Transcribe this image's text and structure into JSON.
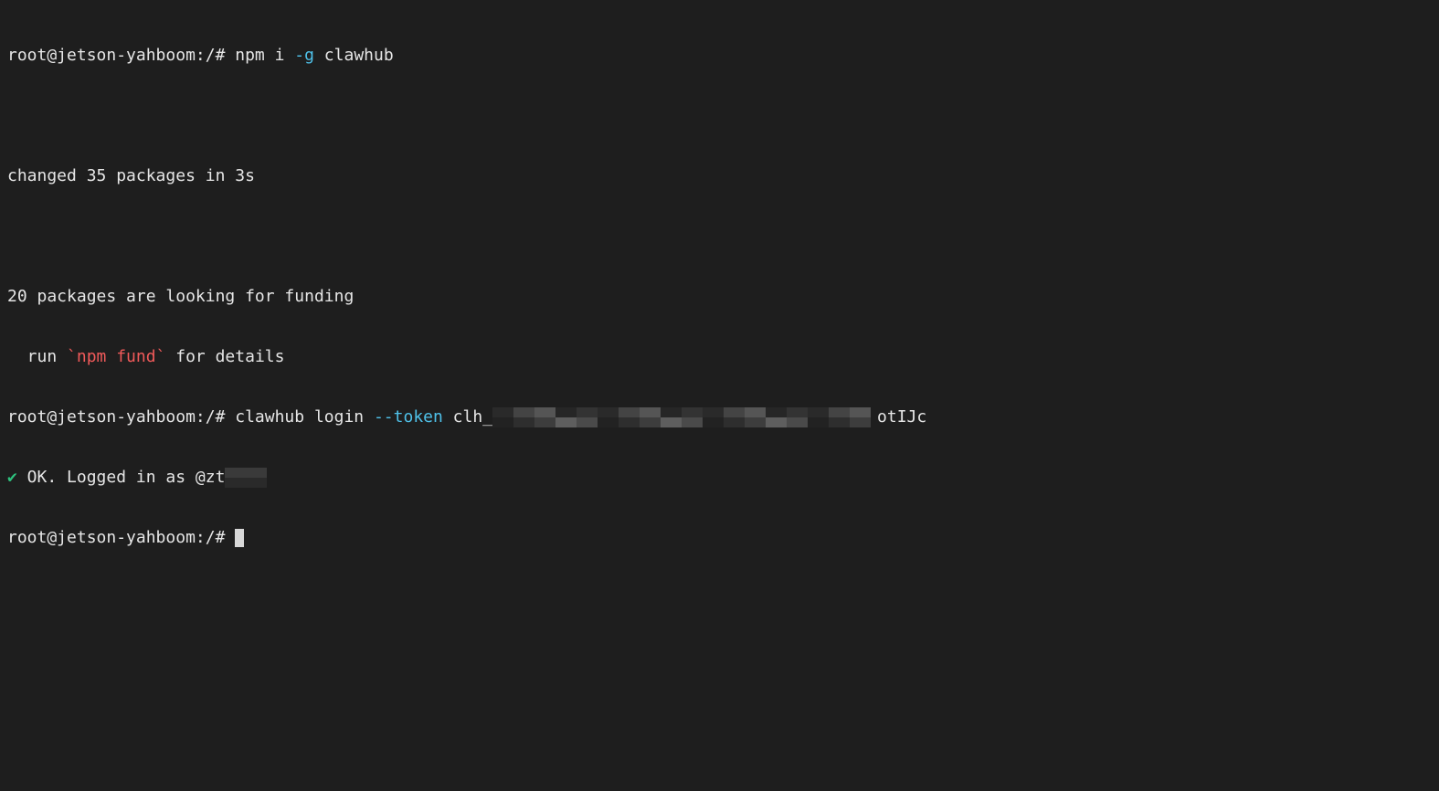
{
  "terminal": {
    "lines": {
      "l1_prompt": "root@jetson-yahboom:/# ",
      "l1_cmd": "npm i ",
      "l1_flag": "-g",
      "l1_arg": " clawhub",
      "l3_text": "changed 35 packages in 3s",
      "l5_text": "20 packages are looking for funding",
      "l6_pre": "  run ",
      "l6_fund": "`npm fund`",
      "l6_post": " for details",
      "l7_prompt": "root@jetson-yahboom:/# ",
      "l7_cmd": "clawhub login ",
      "l7_flag": "--token",
      "l7_token_start": " clh_",
      "l7_token_end": "otIJc",
      "l8_check": "✔",
      "l8_text": " OK. Logged in as @zt",
      "l9_prompt": "root@jetson-yahboom:/# "
    },
    "colors": {
      "background": "#1e1e1e",
      "text": "#e6e6e6",
      "flag": "#4fc1e9",
      "fund": "#f05a5a",
      "check": "#2ec27e"
    }
  }
}
